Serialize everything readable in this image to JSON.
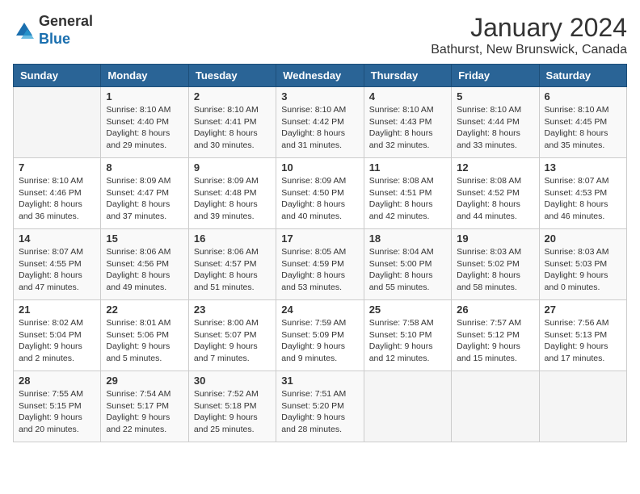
{
  "header": {
    "logo_general": "General",
    "logo_blue": "Blue",
    "title": "January 2024",
    "subtitle": "Bathurst, New Brunswick, Canada"
  },
  "days_of_week": [
    "Sunday",
    "Monday",
    "Tuesday",
    "Wednesday",
    "Thursday",
    "Friday",
    "Saturday"
  ],
  "weeks": [
    [
      {
        "day": "",
        "info": ""
      },
      {
        "day": "1",
        "info": "Sunrise: 8:10 AM\nSunset: 4:40 PM\nDaylight: 8 hours\nand 29 minutes."
      },
      {
        "day": "2",
        "info": "Sunrise: 8:10 AM\nSunset: 4:41 PM\nDaylight: 8 hours\nand 30 minutes."
      },
      {
        "day": "3",
        "info": "Sunrise: 8:10 AM\nSunset: 4:42 PM\nDaylight: 8 hours\nand 31 minutes."
      },
      {
        "day": "4",
        "info": "Sunrise: 8:10 AM\nSunset: 4:43 PM\nDaylight: 8 hours\nand 32 minutes."
      },
      {
        "day": "5",
        "info": "Sunrise: 8:10 AM\nSunset: 4:44 PM\nDaylight: 8 hours\nand 33 minutes."
      },
      {
        "day": "6",
        "info": "Sunrise: 8:10 AM\nSunset: 4:45 PM\nDaylight: 8 hours\nand 35 minutes."
      }
    ],
    [
      {
        "day": "7",
        "info": "Sunrise: 8:10 AM\nSunset: 4:46 PM\nDaylight: 8 hours\nand 36 minutes."
      },
      {
        "day": "8",
        "info": "Sunrise: 8:09 AM\nSunset: 4:47 PM\nDaylight: 8 hours\nand 37 minutes."
      },
      {
        "day": "9",
        "info": "Sunrise: 8:09 AM\nSunset: 4:48 PM\nDaylight: 8 hours\nand 39 minutes."
      },
      {
        "day": "10",
        "info": "Sunrise: 8:09 AM\nSunset: 4:50 PM\nDaylight: 8 hours\nand 40 minutes."
      },
      {
        "day": "11",
        "info": "Sunrise: 8:08 AM\nSunset: 4:51 PM\nDaylight: 8 hours\nand 42 minutes."
      },
      {
        "day": "12",
        "info": "Sunrise: 8:08 AM\nSunset: 4:52 PM\nDaylight: 8 hours\nand 44 minutes."
      },
      {
        "day": "13",
        "info": "Sunrise: 8:07 AM\nSunset: 4:53 PM\nDaylight: 8 hours\nand 46 minutes."
      }
    ],
    [
      {
        "day": "14",
        "info": "Sunrise: 8:07 AM\nSunset: 4:55 PM\nDaylight: 8 hours\nand 47 minutes."
      },
      {
        "day": "15",
        "info": "Sunrise: 8:06 AM\nSunset: 4:56 PM\nDaylight: 8 hours\nand 49 minutes."
      },
      {
        "day": "16",
        "info": "Sunrise: 8:06 AM\nSunset: 4:57 PM\nDaylight: 8 hours\nand 51 minutes."
      },
      {
        "day": "17",
        "info": "Sunrise: 8:05 AM\nSunset: 4:59 PM\nDaylight: 8 hours\nand 53 minutes."
      },
      {
        "day": "18",
        "info": "Sunrise: 8:04 AM\nSunset: 5:00 PM\nDaylight: 8 hours\nand 55 minutes."
      },
      {
        "day": "19",
        "info": "Sunrise: 8:03 AM\nSunset: 5:02 PM\nDaylight: 8 hours\nand 58 minutes."
      },
      {
        "day": "20",
        "info": "Sunrise: 8:03 AM\nSunset: 5:03 PM\nDaylight: 9 hours\nand 0 minutes."
      }
    ],
    [
      {
        "day": "21",
        "info": "Sunrise: 8:02 AM\nSunset: 5:04 PM\nDaylight: 9 hours\nand 2 minutes."
      },
      {
        "day": "22",
        "info": "Sunrise: 8:01 AM\nSunset: 5:06 PM\nDaylight: 9 hours\nand 5 minutes."
      },
      {
        "day": "23",
        "info": "Sunrise: 8:00 AM\nSunset: 5:07 PM\nDaylight: 9 hours\nand 7 minutes."
      },
      {
        "day": "24",
        "info": "Sunrise: 7:59 AM\nSunset: 5:09 PM\nDaylight: 9 hours\nand 9 minutes."
      },
      {
        "day": "25",
        "info": "Sunrise: 7:58 AM\nSunset: 5:10 PM\nDaylight: 9 hours\nand 12 minutes."
      },
      {
        "day": "26",
        "info": "Sunrise: 7:57 AM\nSunset: 5:12 PM\nDaylight: 9 hours\nand 15 minutes."
      },
      {
        "day": "27",
        "info": "Sunrise: 7:56 AM\nSunset: 5:13 PM\nDaylight: 9 hours\nand 17 minutes."
      }
    ],
    [
      {
        "day": "28",
        "info": "Sunrise: 7:55 AM\nSunset: 5:15 PM\nDaylight: 9 hours\nand 20 minutes."
      },
      {
        "day": "29",
        "info": "Sunrise: 7:54 AM\nSunset: 5:17 PM\nDaylight: 9 hours\nand 22 minutes."
      },
      {
        "day": "30",
        "info": "Sunrise: 7:52 AM\nSunset: 5:18 PM\nDaylight: 9 hours\nand 25 minutes."
      },
      {
        "day": "31",
        "info": "Sunrise: 7:51 AM\nSunset: 5:20 PM\nDaylight: 9 hours\nand 28 minutes."
      },
      {
        "day": "",
        "info": ""
      },
      {
        "day": "",
        "info": ""
      },
      {
        "day": "",
        "info": ""
      }
    ]
  ]
}
